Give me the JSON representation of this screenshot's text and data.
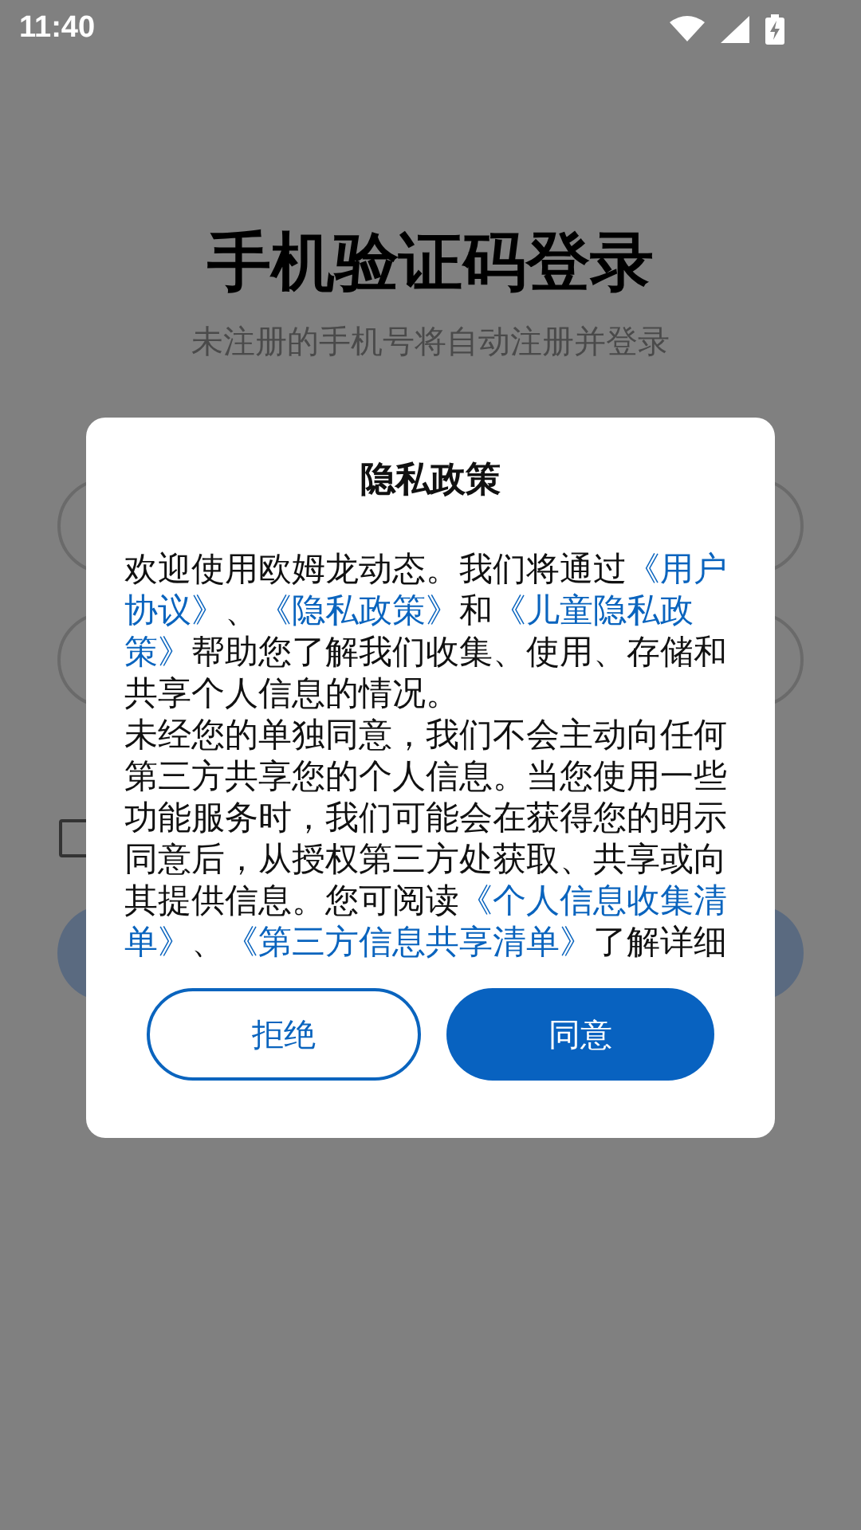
{
  "status_bar": {
    "time": "11:40"
  },
  "page": {
    "title": "手机验证码登录",
    "subtitle": "未注册的手机号将自动注册并登录",
    "agree_checkbox": {
      "checked": false
    }
  },
  "dialog": {
    "title": "隐私政策",
    "paragraphs": [
      [
        {
          "kind": "text",
          "text": "欢迎使用欧姆龙动态。我们将通过"
        },
        {
          "kind": "link",
          "text": "《用户协议》"
        },
        {
          "kind": "text",
          "text": "、"
        },
        {
          "kind": "link",
          "text": "《隐私政策》"
        },
        {
          "kind": "text",
          "text": "和"
        },
        {
          "kind": "link",
          "text": "《儿童隐私政策》"
        },
        {
          "kind": "text",
          "text": "帮助您了解我们收集、使用、存储和共享个人信息的情况。"
        }
      ],
      [
        {
          "kind": "text",
          "text": "未经您的单独同意，我们不会主动向任何第三方共享您的个人信息。当您使用一些功能服务时，我们可能会在获得您的明示同意后，从授权第三方处获取、共享或向其提供信息。您可阅读"
        },
        {
          "kind": "link",
          "text": "《个人信息收集清单》"
        },
        {
          "kind": "text",
          "text": "、"
        },
        {
          "kind": "link",
          "text": "《第三方信息共享清单》"
        },
        {
          "kind": "text",
          "text": "了解详细"
        }
      ]
    ],
    "buttons": [
      {
        "label": "拒绝",
        "kind": "outline"
      },
      {
        "label": "同意",
        "kind": "filled"
      }
    ]
  }
}
